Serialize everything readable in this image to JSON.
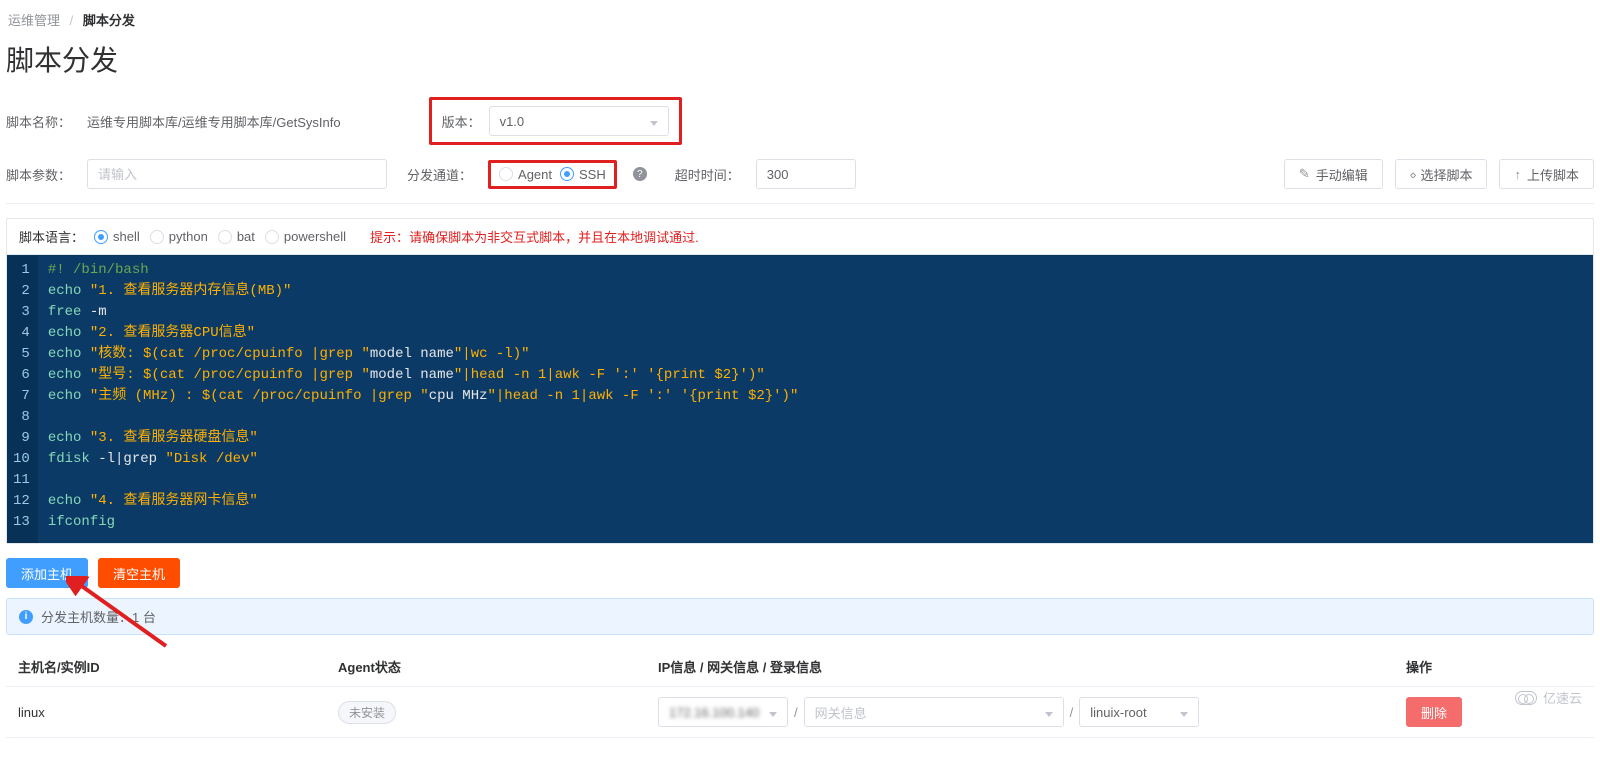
{
  "breadcrumb": {
    "parent": "运维管理",
    "current": "脚本分发"
  },
  "page_title": "脚本分发",
  "row1": {
    "script_name_label": "脚本名称：",
    "script_name_value": "运维专用脚本库/运维专用脚本库/GetSysInfo",
    "version_label": "版本：",
    "version_value": "v1.0"
  },
  "row2": {
    "script_params_label": "脚本参数：",
    "script_params_placeholder": "请输入",
    "dispatch_channel_label": "分发通道：",
    "radio_agent": "Agent",
    "radio_ssh": "SSH",
    "timeout_label": "超时时间：",
    "timeout_value": "300",
    "toolbar": {
      "manual_edit": "手动编辑",
      "select_script": "选择脚本",
      "upload_script": "上传脚本"
    }
  },
  "editor_header": {
    "script_lang_label": "脚本语言：",
    "langs": {
      "shell": "shell",
      "python": "python",
      "bat": "bat",
      "powershell": "powershell"
    },
    "hint_label": "提示：",
    "hint_text": "请确保脚本为非交互式脚本，并且在本地调试通过."
  },
  "code_lines": [
    "#! /bin/bash",
    "echo \"1. 查看服务器内存信息(MB)\"",
    "free -m",
    "echo \"2. 查看服务器CPU信息\"",
    "echo \"核数: $(cat /proc/cpuinfo |grep \"model name\"|wc -l)\"",
    "echo \"型号: $(cat /proc/cpuinfo |grep \"model name\"|head -n 1|awk -F ':' '{print $2}')\"",
    "echo \"主频 (MHz) : $(cat /proc/cpuinfo |grep \"cpu MHz\"|head -n 1|awk -F ':' '{print $2}')\"",
    "",
    "echo \"3. 查看服务器硬盘信息\"",
    "fdisk -l|grep \"Disk /dev\"",
    "",
    "echo \"4. 查看服务器网卡信息\"",
    "ifconfig"
  ],
  "actions": {
    "add_host": "添加主机",
    "clear_hosts": "清空主机"
  },
  "info_strip": "分发主机数量：1 台",
  "table": {
    "headers": {
      "host": "主机名/实例ID",
      "agent": "Agent状态",
      "ip": "IP信息 / 网关信息 / 登录信息",
      "op": "操作"
    },
    "row": {
      "host": "linux",
      "agent_badge": "未安装",
      "ip_value": "172.16.100.140",
      "gateway_placeholder": "网关信息",
      "login_value": "linuix-root",
      "delete": "删除"
    }
  },
  "watermark": "亿速云"
}
